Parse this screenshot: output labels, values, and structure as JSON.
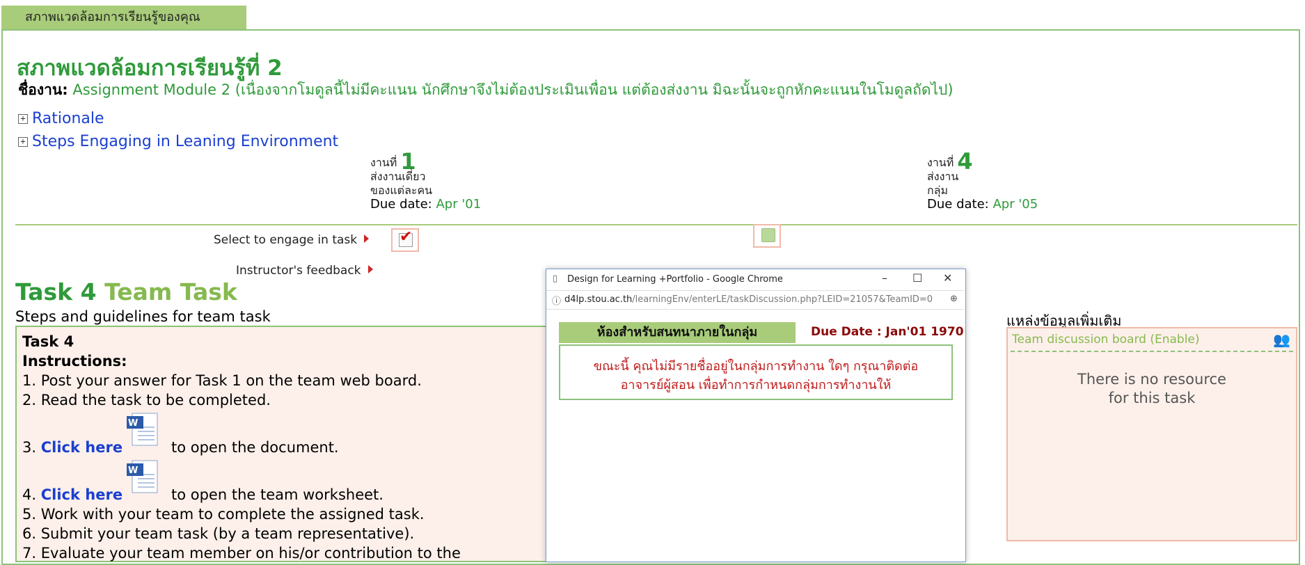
{
  "tab": {
    "label": "สภาพแวดล้อมการเรียนรู้ของคุณ"
  },
  "header": {
    "title": "สภาพแวดล้อมการเรียนรู้ที่ 2",
    "assignment_label": "ชื่องาน:",
    "assignment_text": "Assignment Module 2 (เนื่องจากโมดูลนี้ไม่มีคะแนน นักศึกษาจึงไม่ต้องประเมินเพื่อน แต่ต้องส่งงาน มิฉะนั้นจะถูกหักคะแนนในโมดูลถัดไป)"
  },
  "expanders": [
    {
      "label": "Rationale"
    },
    {
      "label": "Steps Engaging in Leaning Environment"
    }
  ],
  "tasks": [
    {
      "prefix": "งานที่",
      "number": "1",
      "line1": "ส่งงานเดี่ยว",
      "line2": "ของแต่ละคน",
      "due_label": "Due date:",
      "due": "Apr '01"
    },
    {
      "prefix": "งานที่",
      "number": "4",
      "line1": "ส่งงาน",
      "line2": "กลุ่ม",
      "due_label": "Due date:",
      "due": "Apr '05"
    }
  ],
  "rows": {
    "select": "Select to engage in task",
    "feedback": "Instructor's feedback"
  },
  "task_section": {
    "title_num": "Task 4",
    "title_name": "Team Task",
    "steps_heading": "Steps and guidelines for team task",
    "panel_title": "Task 4",
    "instructions": "Instructions:",
    "step1": "1. Post your answer for Task 1 on the team web board.",
    "step2": "2. Read the task to be completed.",
    "step3_num": "3.",
    "step3_link": "Click here",
    "step3_rest": "to open the document.",
    "step4_num": "4.",
    "step4_link": "Click here",
    "step4_rest": "to open the team worksheet.",
    "step5": "5. Work with your team to complete the assigned task.",
    "step6": "6. Submit your team task (by a team representative).",
    "step7": "7. Evaluate your team member on his/or contribution to the"
  },
  "popup": {
    "window_title": "Design for Learning +Portfolio - Google Chrome",
    "url_host": "d4lp.stou.ac.th",
    "url_path": "/learningEnv/enterLE/taskDiscussion.php?LEID=21057&TeamID=0",
    "room_heading": "ห้องสำหรับสนทนาภายในกลุ่ม",
    "due": "Due Date : Jan'01 1970",
    "message_line1": "ขณะนี้ คุณไม่มีรายชื่ออยู่ในกลุ่มการทำงาน ใดๆ กรุณาติดต่อ",
    "message_line2": "อาจารย์ผู้สอน เพื่อทำการกำหนดกลุ่มการทำงานให้"
  },
  "resources": {
    "heading": "แหล่งข้อมูลเพิ่มเติม",
    "board_link": "Team discussion board",
    "board_status": "(Enable)",
    "empty_line1": "There is no resource",
    "empty_line2": "for this task"
  },
  "colors": {
    "green": "#2f9a3a",
    "tab_green": "#a8cc7a",
    "link_blue": "#1a3fd0",
    "due_red": "#8b0a0a"
  }
}
